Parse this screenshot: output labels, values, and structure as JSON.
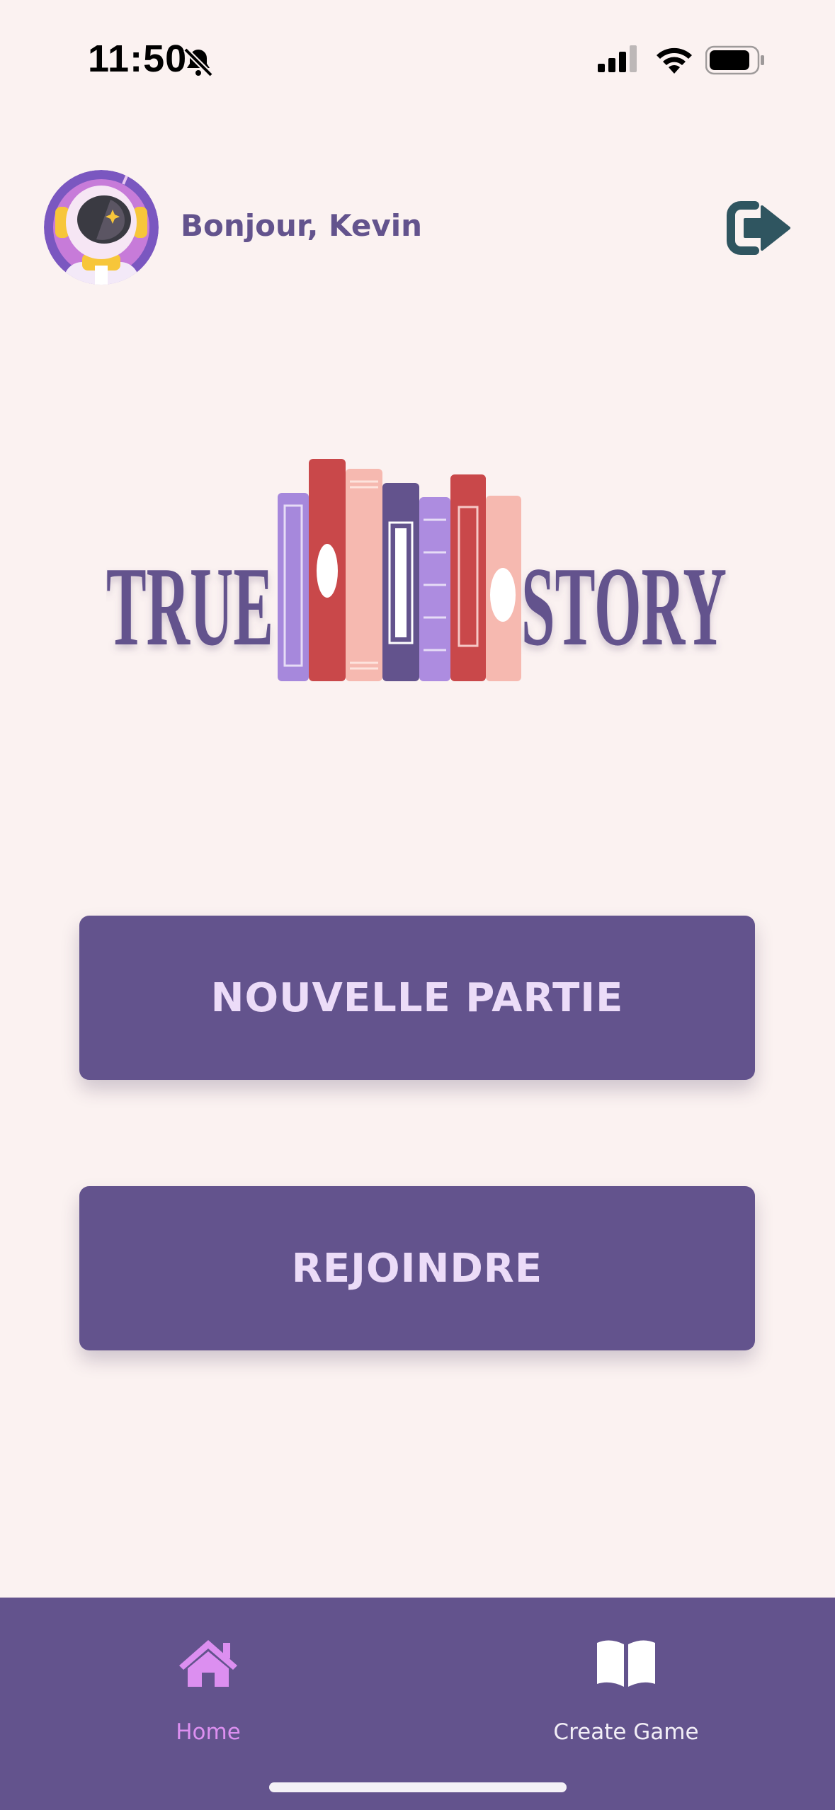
{
  "status_bar": {
    "time": "11:50"
  },
  "header": {
    "greeting": "Bonjour, Kevin"
  },
  "logo": {
    "word_left": "TRUE",
    "word_right": "STORY"
  },
  "buttons": {
    "new_game": "NOUVELLE PARTIE",
    "join": "REJOINDRE"
  },
  "nav": {
    "home_label": "Home",
    "create_label": "Create Game",
    "active": "Home"
  },
  "colors": {
    "background": "#fbf2f1",
    "primary": "#63538d",
    "button_text": "#ecdcf8",
    "nav_active": "#dc8ff0",
    "logout_icon": "#2f5560"
  }
}
